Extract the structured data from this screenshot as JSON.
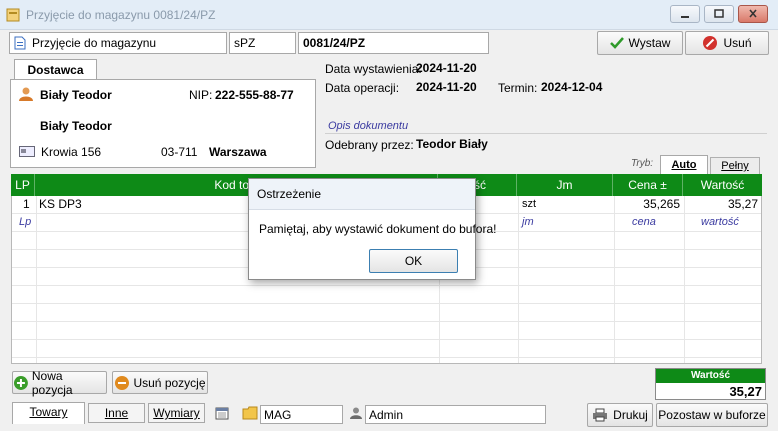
{
  "window": {
    "title": "Przyjęcie do magazynu 0081/24/PZ"
  },
  "toolbar": {
    "doc_type": "Przyjęcie do magazynu",
    "series": "sPZ",
    "doc_number": "0081/24/PZ",
    "issue_label": "Wystaw",
    "delete_label": "Usuń"
  },
  "supplier": {
    "tab_label": "Dostawca",
    "name": "Biały Teodor",
    "nip_label": "NIP:",
    "nip": "222-555-88-77",
    "full_name": "Biały Teodor",
    "street": "Krowia 156",
    "postal": "03-711",
    "city": "Warszawa"
  },
  "dates": {
    "issue_label": "Data wystawienia:",
    "issue_value": "2024-11-20",
    "op_label": "Data operacji:",
    "op_value": "2024-11-20",
    "term_label": "Termin:",
    "term_value": "2024-12-04",
    "desc_placeholder": "Opis dokumentu",
    "receiver_label": "Odebrany przez:",
    "receiver_value": "Teodor Biały"
  },
  "mode": {
    "label": "Tryb:",
    "auto": "Auto",
    "full": "Pełny"
  },
  "grid": {
    "headers": {
      "lp": "LP",
      "code": "Kod tow",
      "qty": "ość",
      "unit": "Jm",
      "price": "Cena ±",
      "value": "Wartość"
    },
    "row1": {
      "lp": "1",
      "code": "KS DP3",
      "unit": "szt",
      "price": "35,265",
      "value": "35,27"
    },
    "newrow": {
      "lp": "Lp",
      "unit": "jm",
      "price": "cena",
      "value": "wartość"
    }
  },
  "dialog": {
    "title": "Ostrzeżenie",
    "message": "Pamiętaj, aby wystawić dokument do bufora!",
    "ok_label": "OK"
  },
  "actions": {
    "add_label": "Nowa pozycja",
    "remove_label": "Usuń pozycję"
  },
  "total": {
    "label": "Wartość",
    "value": "35,27"
  },
  "bottom": {
    "tab_goods": "Towary",
    "tab_other": "Inne",
    "tab_dims": "Wymiary",
    "warehouse": "MAG",
    "user": "Admin",
    "print_label": "Drukuj",
    "buffer_label": "Pozostaw w buforze"
  },
  "colors": {
    "header_green": "#0e8a17",
    "delete_red": "#d2322d",
    "add_green": "#3a9d2a",
    "remove_orange": "#e08a1e"
  }
}
